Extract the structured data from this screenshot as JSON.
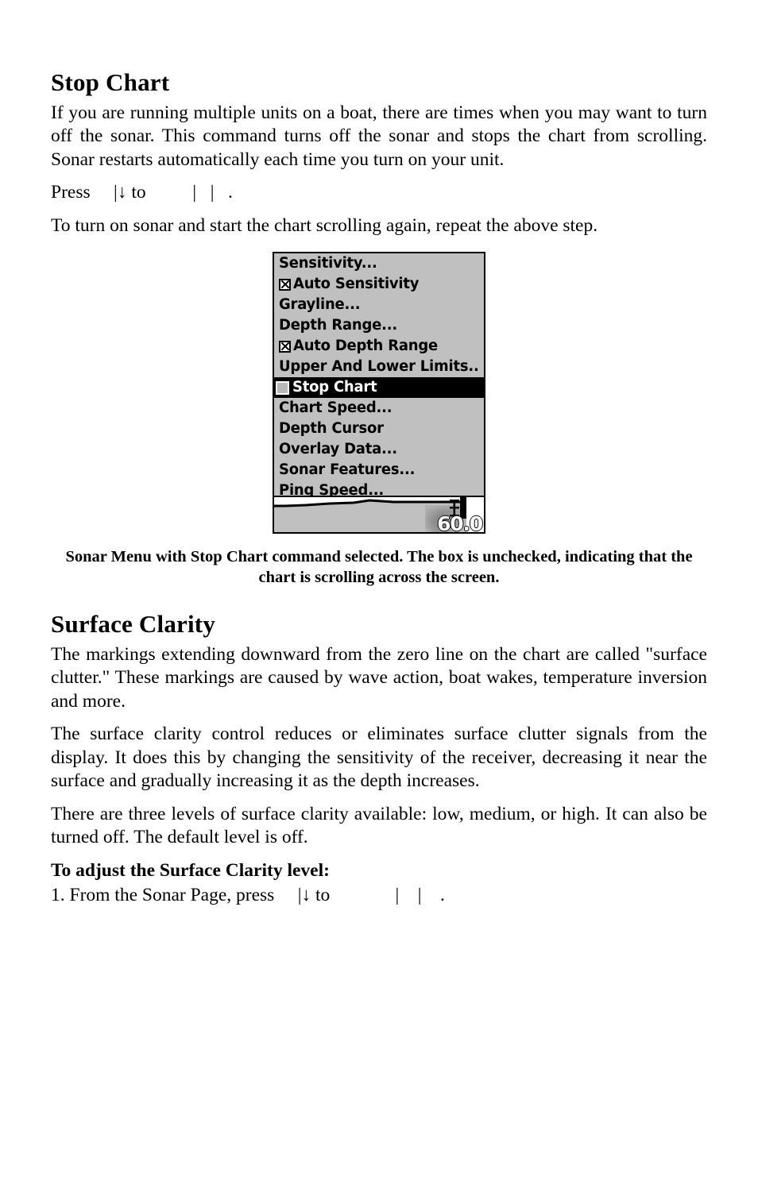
{
  "document": {
    "section1": {
      "heading": "Stop Chart",
      "paragraph1": "If you are running multiple units on a boat, there are times when you may want to turn off the sonar. This command turns off the sonar and stops the chart from scrolling. Sonar restarts automatically each time you turn on your unit.",
      "press_line": {
        "prefix": "Press",
        "gap1": "     ",
        "arrow_keys": "|↓ to",
        "gap2": "          ",
        "pipe1": "|",
        "gap3": "   ",
        "pipe2": "|",
        "gap4": "   ",
        "period": "."
      },
      "paragraph2": "To turn on sonar and start the chart scrolling again, repeat the above step."
    },
    "figure": {
      "caption": "Sonar Menu with Stop Chart command selected. The box is unchecked, indicating that the chart is scrolling across the screen.",
      "depth_readout": "60.0",
      "menu_items": [
        {
          "label": "Sensitivity...",
          "checkbox": "none",
          "selected": false
        },
        {
          "label": "Auto Sensitivity",
          "checkbox": "checked",
          "selected": false
        },
        {
          "label": "Grayline...",
          "checkbox": "none",
          "selected": false
        },
        {
          "label": "Depth Range...",
          "checkbox": "none",
          "selected": false
        },
        {
          "label": "Auto Depth Range",
          "checkbox": "checked",
          "selected": false
        },
        {
          "label": "Upper And Lower Limits..",
          "checkbox": "none",
          "selected": false
        },
        {
          "label": "Stop Chart",
          "checkbox": "unchecked",
          "selected": true
        },
        {
          "label": "Chart Speed...",
          "checkbox": "none",
          "selected": false
        },
        {
          "label": "Depth Cursor",
          "checkbox": "none",
          "selected": false
        },
        {
          "label": "Overlay Data...",
          "checkbox": "none",
          "selected": false
        },
        {
          "label": "Sonar Features...",
          "checkbox": "none",
          "selected": false
        },
        {
          "label": "Ping Speed...",
          "checkbox": "none",
          "selected": false
        }
      ]
    },
    "section2": {
      "heading": "Surface Clarity",
      "paragraph1": "The markings extending downward from the zero line on the chart are called \"surface clutter.\" These markings are caused by wave action, boat wakes, temperature inversion and more.",
      "paragraph2": "The surface clarity control reduces or eliminates surface clutter signals from the display. It does this by changing the sensitivity of the receiver, decreasing it near the surface and gradually increasing it as the depth increases.",
      "paragraph3": "There are three levels of surface clarity available: low, medium, or high. It can also be turned off. The default level is off.",
      "subheading": "To adjust the Surface Clarity level:",
      "step1": {
        "prefix": "1. From the Sonar Page, press",
        "gap1": "     ",
        "arrow_keys": "|↓ to",
        "gap2": "              ",
        "pipe1": "|",
        "gap3": "    ",
        "pipe2": "|",
        "gap4": "    ",
        "period": "."
      }
    }
  },
  "colors": {
    "page_background": "#ffffff",
    "text": "#000000",
    "lcd_background": "#c0c0c0",
    "lcd_highlight": "#000000",
    "lcd_highlight_text": "#ffffff",
    "lcd_border": "#000000"
  }
}
